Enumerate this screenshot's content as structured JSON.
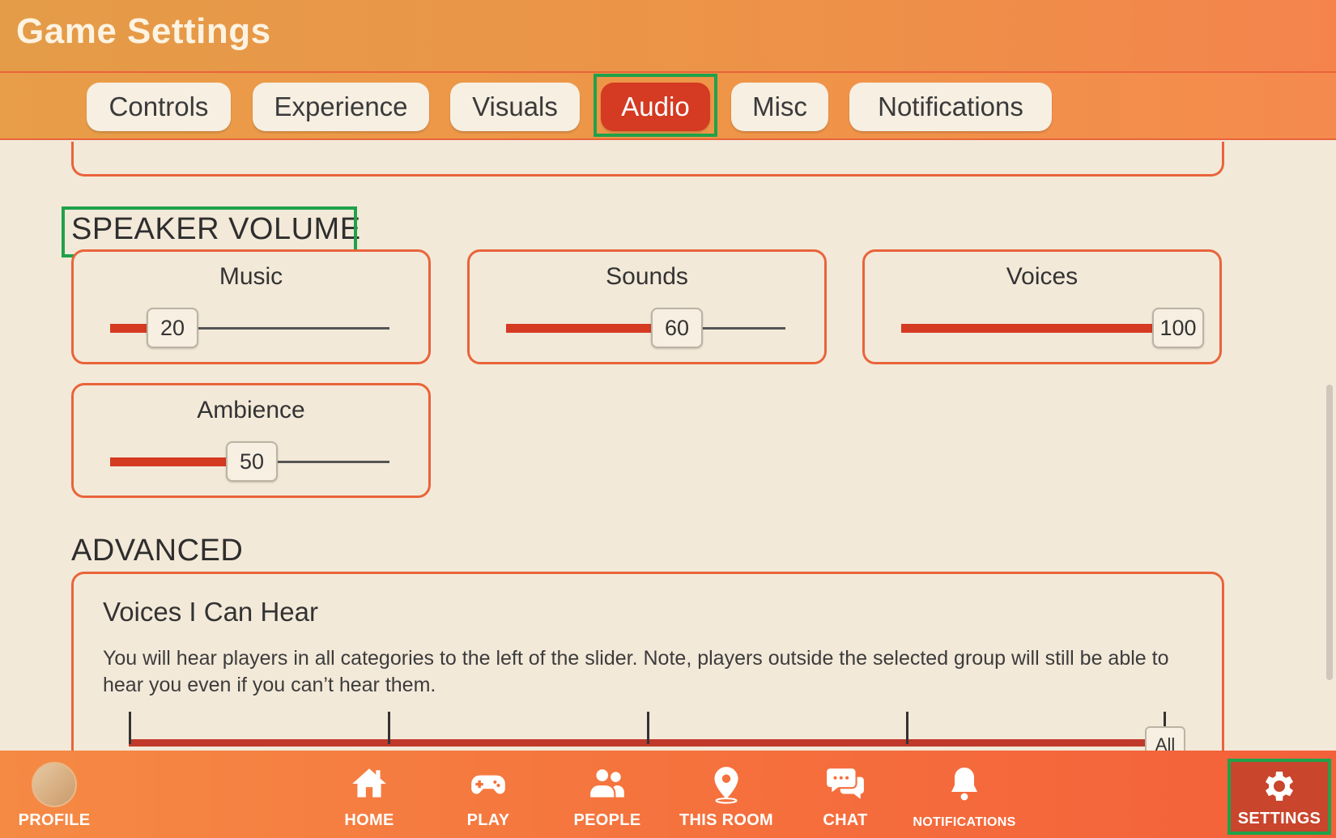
{
  "header": {
    "title": "Game Settings"
  },
  "tabs": [
    {
      "label": "Controls"
    },
    {
      "label": "Experience"
    },
    {
      "label": "Visuals"
    },
    {
      "label": "Audio",
      "active": true
    },
    {
      "label": "Misc"
    },
    {
      "label": "Notifications"
    }
  ],
  "speaker_volume": {
    "title": "SPEAKER VOLUME",
    "sliders": [
      {
        "label": "Music",
        "value": "20",
        "percent": 20
      },
      {
        "label": "Sounds",
        "value": "60",
        "percent": 60
      },
      {
        "label": "Voices",
        "value": "100",
        "percent": 100
      },
      {
        "label": "Ambience",
        "value": "50",
        "percent": 50
      }
    ]
  },
  "advanced": {
    "title": "ADVANCED",
    "card_title": "Voices I Can Hear",
    "description": "You will hear players in all categories to the left of the slider. Note, players outside the selected group will still be able to hear you even if you can’t hear them.",
    "slider_value": "All"
  },
  "bottom_nav": {
    "profile": "PROFILE",
    "home": "HOME",
    "play": "PLAY",
    "people": "PEOPLE",
    "this_room": "THIS ROOM",
    "chat": "CHAT",
    "notifications": "NOTIFICATIONS",
    "settings": "SETTINGS"
  },
  "colors": {
    "accent": "#d53a22",
    "border": "#e9643a",
    "background": "#f3e9d9",
    "highlight": "#1fa24a"
  }
}
